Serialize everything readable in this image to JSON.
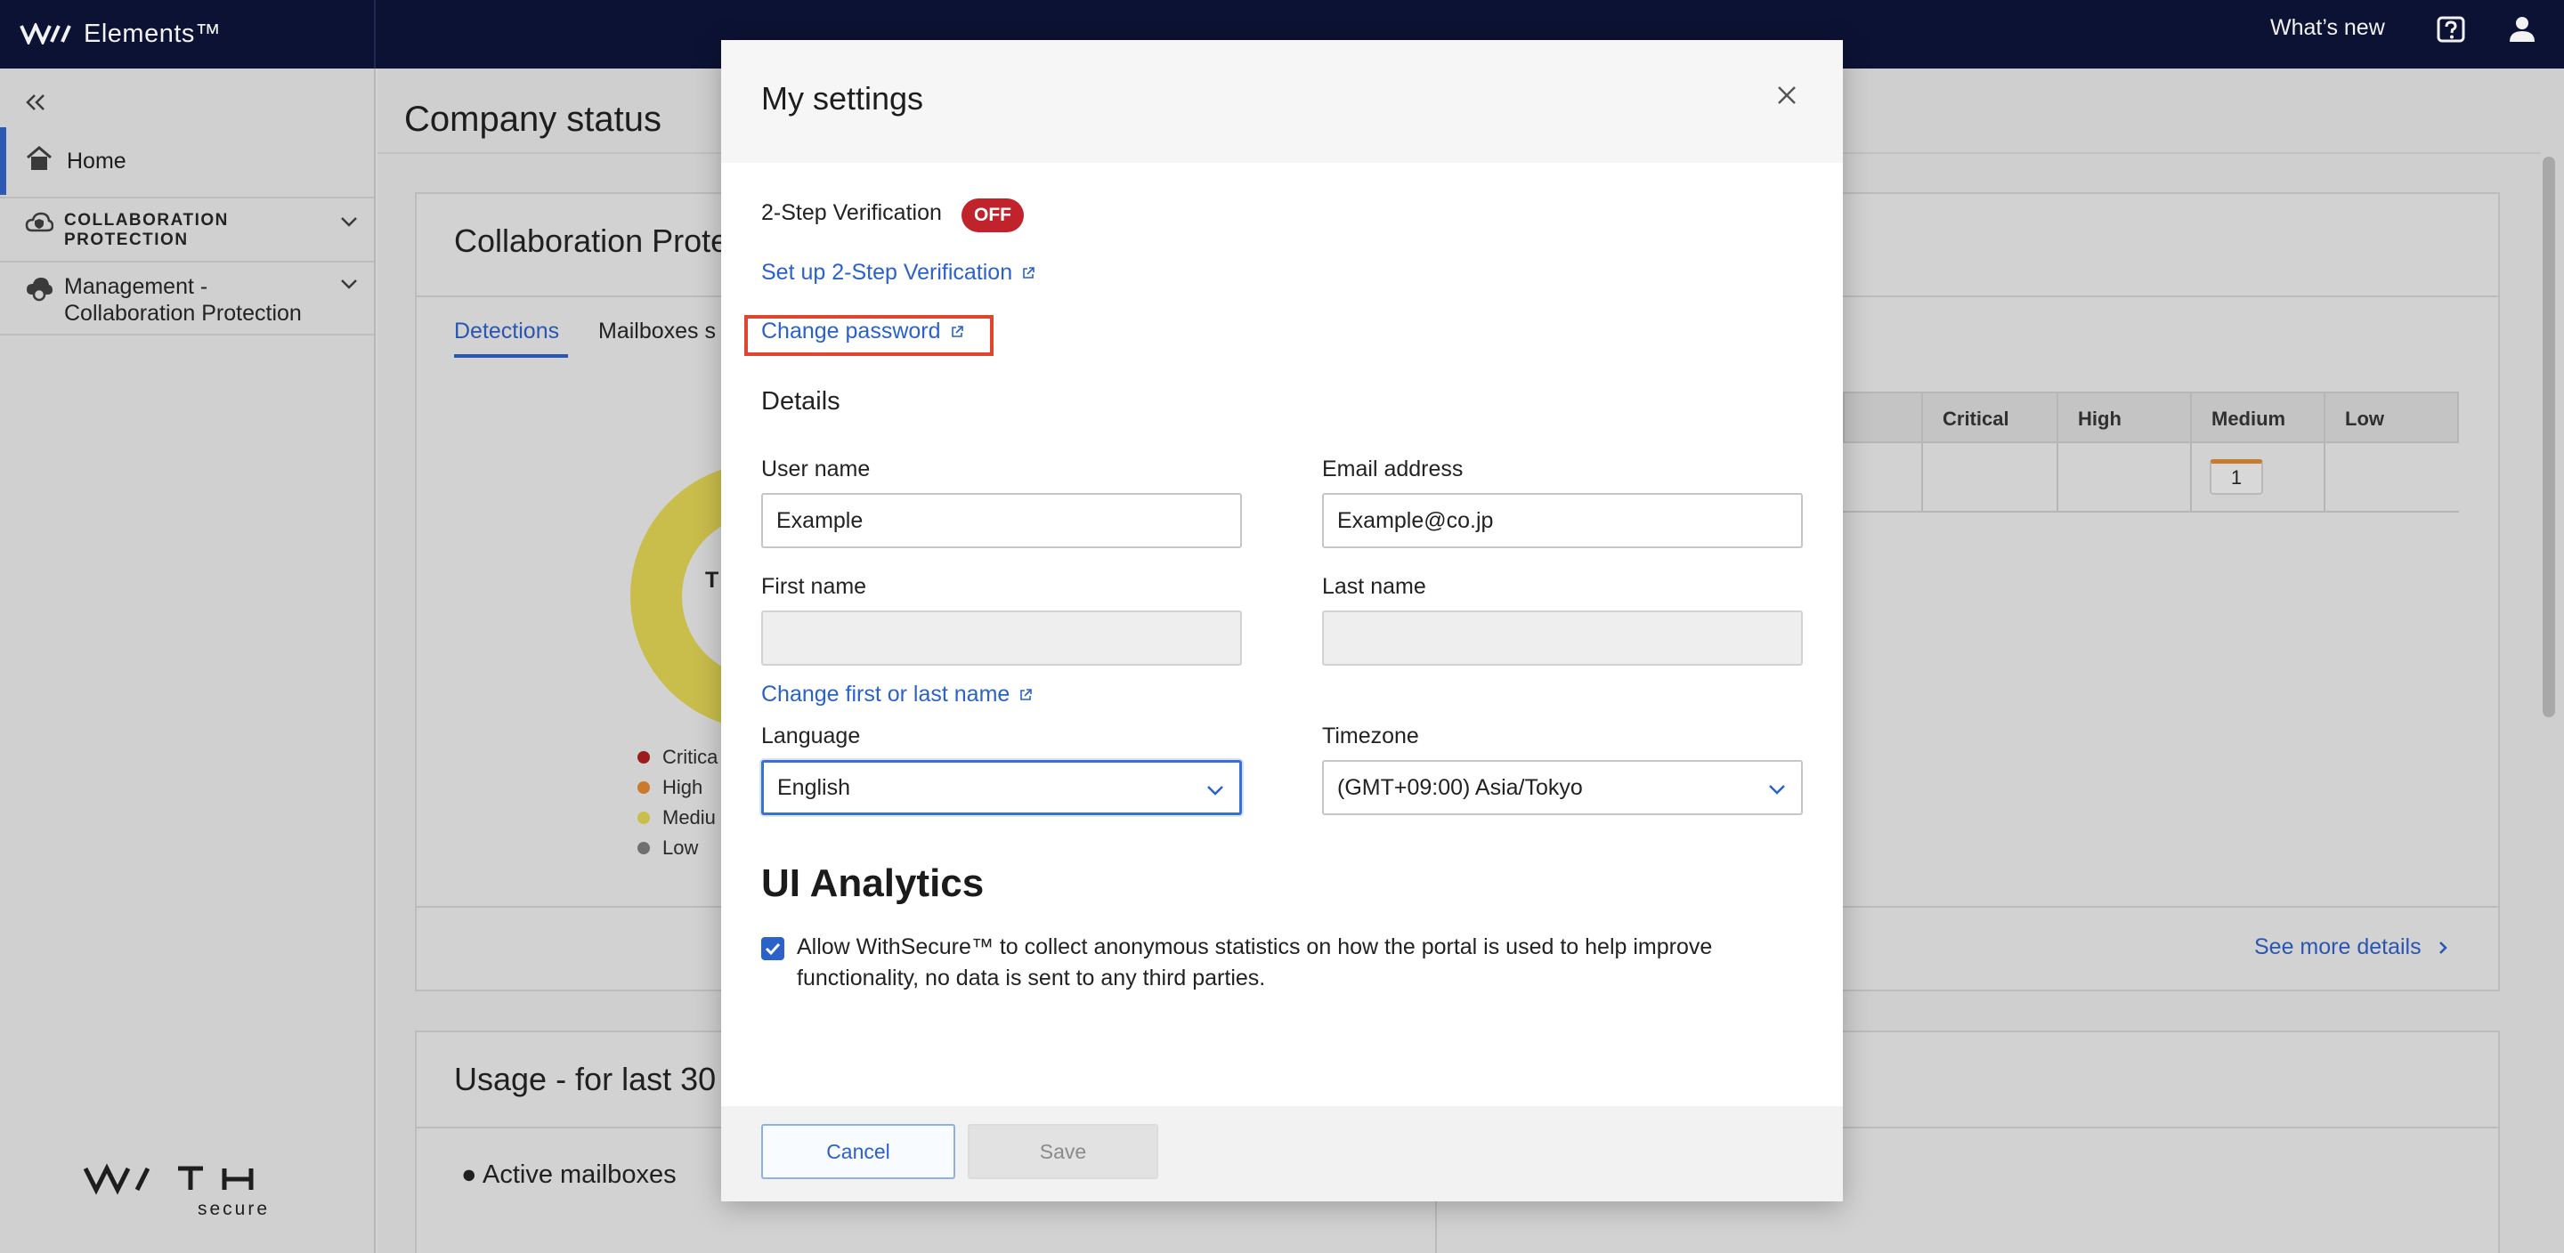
{
  "app": {
    "brand": "Elements™"
  },
  "topbar": {
    "whats_new": "What’s new"
  },
  "sidebar": {
    "home": "Home",
    "section1": [
      "COLLABORATION",
      "PROTECTION"
    ],
    "section2": [
      "Management -",
      "Collaboration Protection"
    ],
    "logo_word": "W/TH",
    "logo_sub": "secure"
  },
  "content": {
    "page_title": "Company status",
    "card_title": "Collaboration Prote",
    "tabs": [
      "Detections",
      "Mailboxes s"
    ],
    "donut_label": "T",
    "legend": [
      "Critica",
      "High",
      "Mediu",
      "Low"
    ],
    "legend_colors": [
      "#9b1c1c",
      "#c97a2b",
      "#c9be4c",
      "#6f6f6f"
    ],
    "table_headers": [
      "Critical",
      "High",
      "Medium",
      "Low"
    ],
    "medium_count": "1",
    "see_more": "See more details",
    "usage_title": "Usage - for last 30",
    "active_mailboxes": "Active mailboxes"
  },
  "modal": {
    "title": "My settings",
    "two_step_label": "2-Step Verification",
    "two_step_status": "OFF",
    "setup_link": "Set up 2-Step Verification",
    "change_password": "Change password",
    "details_heading": "Details",
    "user_name_label": "User name",
    "user_name_value": "Example",
    "email_label": "Email address",
    "email_value": "Example@co.jp",
    "first_name_label": "First name",
    "first_name_value": "",
    "last_name_label": "Last name",
    "last_name_value": "",
    "change_name_link": "Change first or last name",
    "language_label": "Language",
    "language_value": "English",
    "timezone_label": "Timezone",
    "timezone_value": "(GMT+09:00) Asia/Tokyo",
    "analytics_heading": "UI Analytics",
    "analytics_checked": true,
    "analytics_text": "Allow WithSecure™ to collect anonymous statistics on how the portal is used to help improve functionality, no data is sent to any third parties.",
    "cancel": "Cancel",
    "save": "Save"
  },
  "colors": {
    "topbar_bg": "#0c1233",
    "link": "#2a62c9",
    "off_badge": "#c0232c",
    "highlight": "#e0452d",
    "sidebar_active": "#2d5ab4"
  }
}
